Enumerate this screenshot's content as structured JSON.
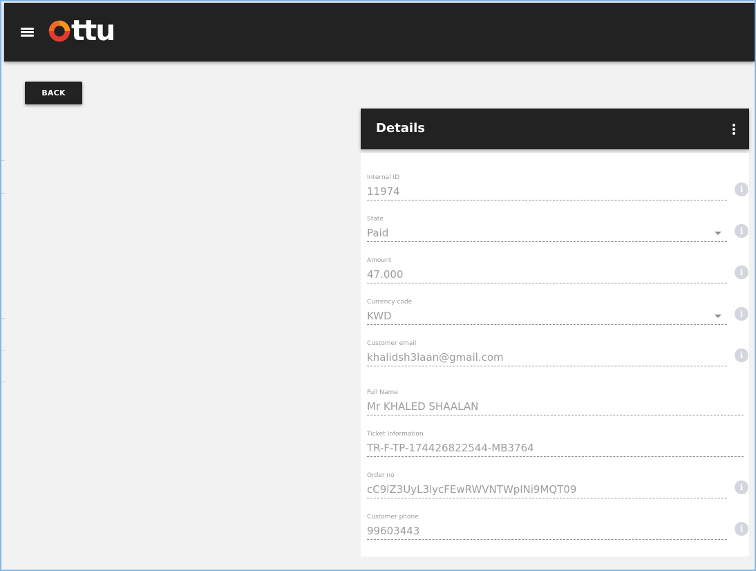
{
  "header": {
    "logo_text": "ttu",
    "menu_icon": "hamburger-menu-icon"
  },
  "back_button": {
    "label": "BACK"
  },
  "details": {
    "title": "Details",
    "fields": [
      {
        "label": "Internal ID",
        "value": "11974",
        "has_info": true,
        "dropdown": false
      },
      {
        "label": "State",
        "value": "Paid",
        "has_info": true,
        "dropdown": true
      },
      {
        "label": "Amount",
        "value": "47.000",
        "has_info": true,
        "dropdown": false
      },
      {
        "label": "Currency code",
        "value": "KWD",
        "has_info": true,
        "dropdown": true
      },
      {
        "label": "Customer email",
        "value": "khalidsh3laan@gmail.com",
        "has_info": true,
        "dropdown": false
      },
      {
        "label": "Full Name",
        "value": "Mr KHALED SHAALAN",
        "has_info": false,
        "dropdown": false
      },
      {
        "label": "Ticket Information",
        "value": "TR-F-TP-174426822544-MB3764",
        "has_info": false,
        "dropdown": false
      },
      {
        "label": "Order no",
        "value": "cC9lZ3UyL3lycFEwRWVNTWplNi9MQT09",
        "has_info": true,
        "dropdown": false
      },
      {
        "label": "Customer phone",
        "value": "99603443",
        "has_info": true,
        "dropdown": false
      }
    ]
  },
  "colors": {
    "header_bg": "#222222",
    "page_bg": "#f2f2f2",
    "logo_orange": "#f7941d",
    "logo_red": "#e63a2e",
    "field_text": "#9d9d9d",
    "info_icon": "#d3d6dd"
  }
}
